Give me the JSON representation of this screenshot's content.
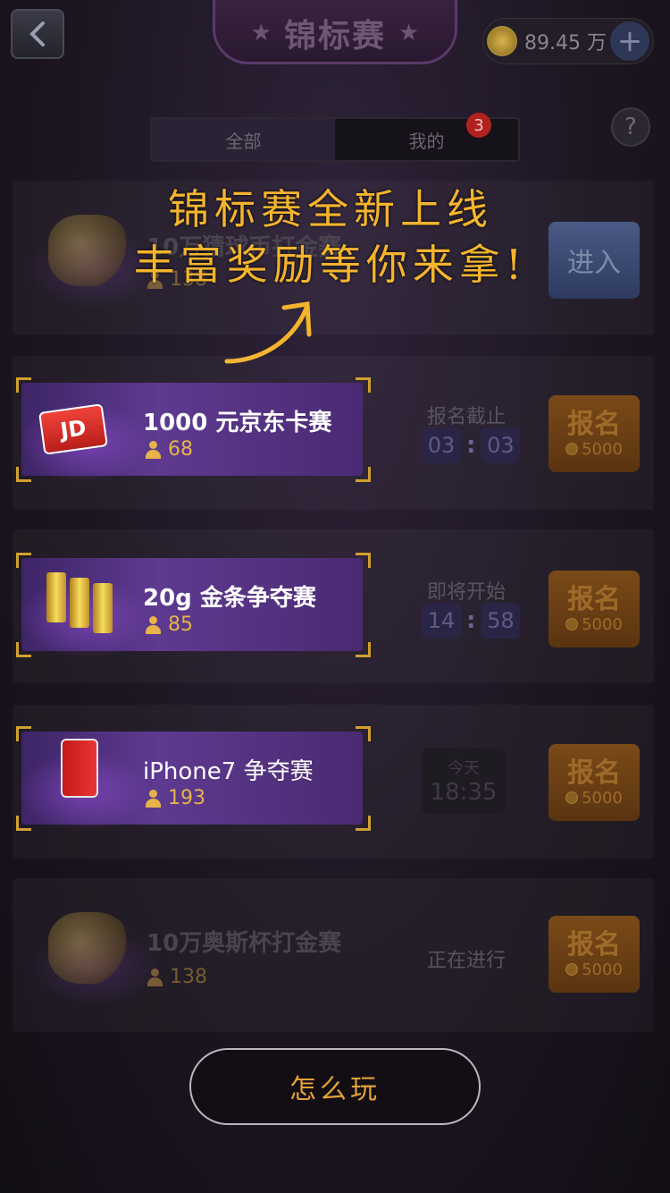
{
  "header": {
    "title": "锦标赛",
    "coins": "89.45 万",
    "plus": "+",
    "help": "?"
  },
  "tabs": [
    {
      "label": "全部"
    },
    {
      "label": "我的"
    }
  ],
  "badge": "3",
  "overlay": {
    "line1": "锦标赛全新上线",
    "line2": "丰富奖励等你来拿!"
  },
  "rows": [
    {
      "title": "10万猜球币打金赛",
      "count": "138",
      "action": "进入"
    },
    {
      "title": "1000 元京东卡赛",
      "count": "68",
      "status": "报名截止",
      "h": "03",
      "m": "03",
      "btn": "报名",
      "fee": "5000",
      "product_label": "JD"
    },
    {
      "title": "20g 金条争夺赛",
      "count": "85",
      "status": "即将开始",
      "h": "14",
      "m": "58",
      "btn": "报名",
      "fee": "5000"
    },
    {
      "title": "iPhone7 争夺赛",
      "count": "193",
      "day": "今天",
      "time": "18:35",
      "btn": "报名",
      "fee": "5000"
    },
    {
      "title": "10万奥斯杯打金赛",
      "count": "138",
      "status": "正在进行",
      "btn": "报名",
      "fee": "5000"
    }
  ],
  "how_to_play": "怎么玩",
  "colors": {
    "accent": "#f4b42e",
    "card": "#5e3a90",
    "signup": "#7a4a18"
  }
}
